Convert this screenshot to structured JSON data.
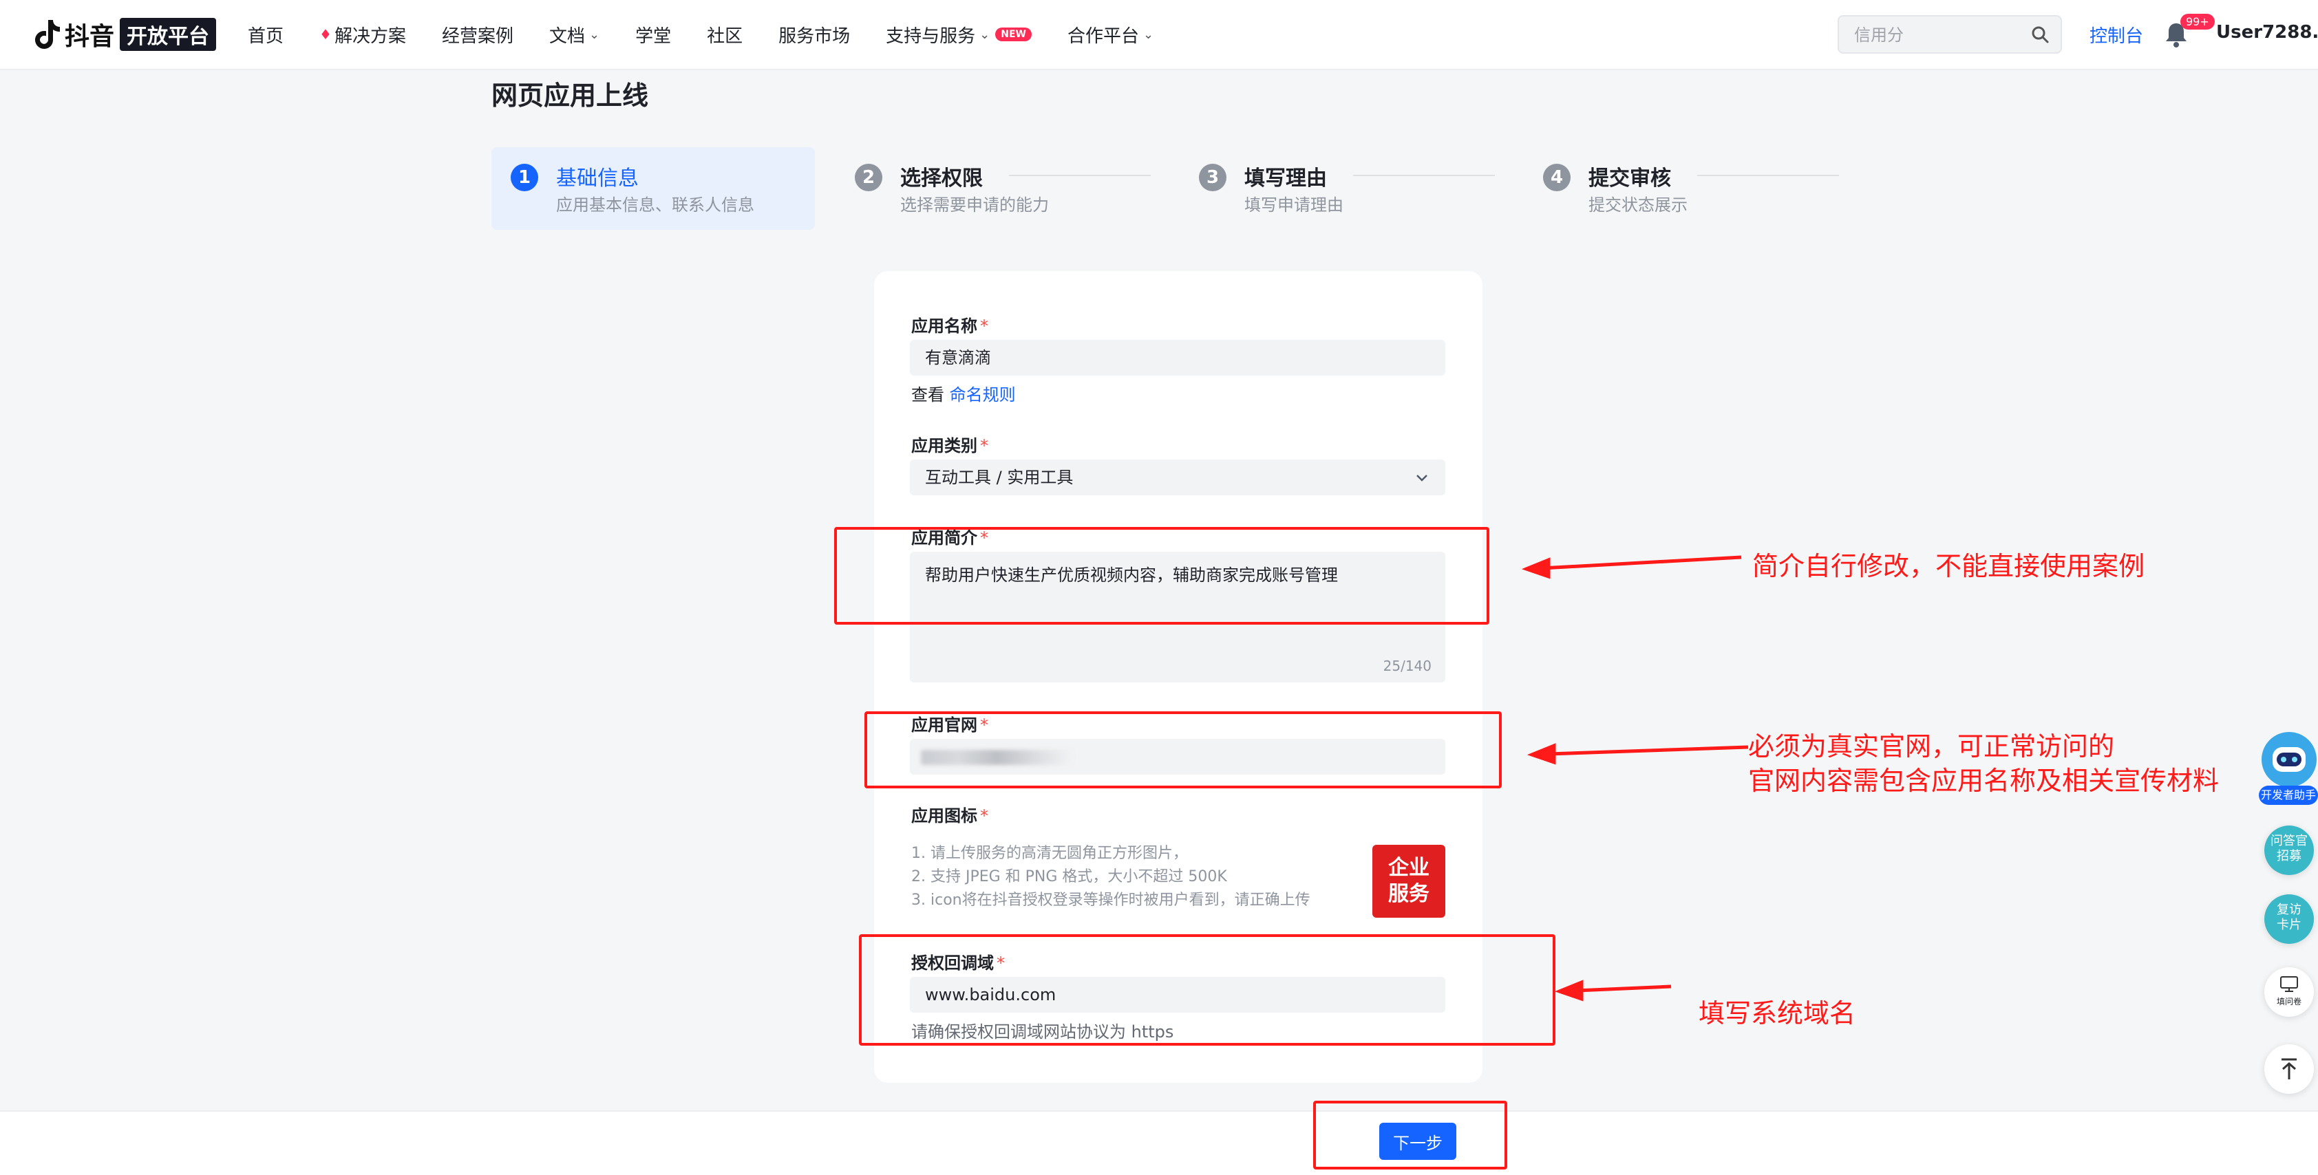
{
  "topbar": {
    "logo_text": "抖音",
    "logo_box": "开放平台",
    "nav": [
      {
        "label": "首页"
      },
      {
        "label": "解决方案"
      },
      {
        "label": "经营案例"
      },
      {
        "label": "文档"
      },
      {
        "label": "学堂"
      },
      {
        "label": "社区"
      },
      {
        "label": "服务市场"
      },
      {
        "label": "支持与服务"
      },
      {
        "label": "合作平台"
      }
    ],
    "new_badge": "NEW",
    "search_placeholder": "信用分",
    "console": "控制台",
    "bell_badge": "99+",
    "user": "User7288..."
  },
  "page": {
    "title": "网页应用上线"
  },
  "steps": [
    {
      "num": "1",
      "title": "基础信息",
      "sub": "应用基本信息、联系人信息"
    },
    {
      "num": "2",
      "title": "选择权限",
      "sub": "选择需要申请的能力"
    },
    {
      "num": "3",
      "title": "填写理由",
      "sub": "填写申请理由"
    },
    {
      "num": "4",
      "title": "提交审核",
      "sub": "提交状态展示"
    }
  ],
  "form": {
    "required_mark": "*",
    "app_name": {
      "label": "应用名称",
      "value": "有意滴滴",
      "rule_prefix": "查看",
      "rule_link": "命名规则"
    },
    "app_category": {
      "label": "应用类别",
      "value": "互动工具 / 实用工具"
    },
    "app_intro": {
      "label": "应用简介",
      "value": "帮助用户快速生产优质视频内容，辅助商家完成账号管理",
      "count": "25/140"
    },
    "app_website": {
      "label": "应用官网"
    },
    "app_icon": {
      "label": "应用图标",
      "hints": [
        "1. 请上传服务的高清无圆角正方形图片，",
        "2. 支持 JPEG 和 PNG 格式，大小不超过 500K",
        "3. icon将在抖音授权登录等操作时被用户看到，请正确上传"
      ],
      "image_text_1": "企业",
      "image_text_2": "服务"
    },
    "callback_domain": {
      "label": "授权回调域",
      "value": "www.baidu.com",
      "hint": "请确保授权回调域网站协议为 https"
    }
  },
  "footer": {
    "next_button": "下一步"
  },
  "annotations": {
    "intro_note": "简介自行修改，不能直接使用案例",
    "website_note_1": "必须为真实官网，可正常访问的",
    "website_note_2": "官网内容需包含应用名称及相关宣传材料",
    "domain_note": "填写系统域名",
    "color": "#ff1a1a"
  },
  "floating": {
    "robot_label": "开发者助手",
    "survey": "问答官招募",
    "card_1": "复访",
    "card_2": "卡片",
    "feedback": "填问卷"
  }
}
